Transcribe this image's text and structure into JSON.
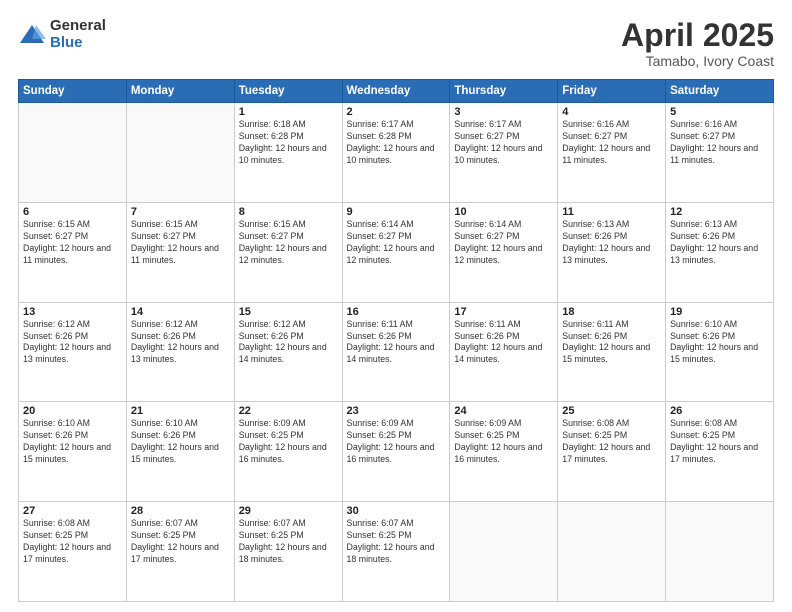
{
  "logo": {
    "general": "General",
    "blue": "Blue"
  },
  "header": {
    "title": "April 2025",
    "subtitle": "Tamabo, Ivory Coast"
  },
  "weekdays": [
    "Sunday",
    "Monday",
    "Tuesday",
    "Wednesday",
    "Thursday",
    "Friday",
    "Saturday"
  ],
  "weeks": [
    [
      {
        "day": "",
        "info": ""
      },
      {
        "day": "",
        "info": ""
      },
      {
        "day": "1",
        "info": "Sunrise: 6:18 AM\nSunset: 6:28 PM\nDaylight: 12 hours and 10 minutes."
      },
      {
        "day": "2",
        "info": "Sunrise: 6:17 AM\nSunset: 6:28 PM\nDaylight: 12 hours and 10 minutes."
      },
      {
        "day": "3",
        "info": "Sunrise: 6:17 AM\nSunset: 6:27 PM\nDaylight: 12 hours and 10 minutes."
      },
      {
        "day": "4",
        "info": "Sunrise: 6:16 AM\nSunset: 6:27 PM\nDaylight: 12 hours and 11 minutes."
      },
      {
        "day": "5",
        "info": "Sunrise: 6:16 AM\nSunset: 6:27 PM\nDaylight: 12 hours and 11 minutes."
      }
    ],
    [
      {
        "day": "6",
        "info": "Sunrise: 6:15 AM\nSunset: 6:27 PM\nDaylight: 12 hours and 11 minutes."
      },
      {
        "day": "7",
        "info": "Sunrise: 6:15 AM\nSunset: 6:27 PM\nDaylight: 12 hours and 11 minutes."
      },
      {
        "day": "8",
        "info": "Sunrise: 6:15 AM\nSunset: 6:27 PM\nDaylight: 12 hours and 12 minutes."
      },
      {
        "day": "9",
        "info": "Sunrise: 6:14 AM\nSunset: 6:27 PM\nDaylight: 12 hours and 12 minutes."
      },
      {
        "day": "10",
        "info": "Sunrise: 6:14 AM\nSunset: 6:27 PM\nDaylight: 12 hours and 12 minutes."
      },
      {
        "day": "11",
        "info": "Sunrise: 6:13 AM\nSunset: 6:26 PM\nDaylight: 12 hours and 13 minutes."
      },
      {
        "day": "12",
        "info": "Sunrise: 6:13 AM\nSunset: 6:26 PM\nDaylight: 12 hours and 13 minutes."
      }
    ],
    [
      {
        "day": "13",
        "info": "Sunrise: 6:12 AM\nSunset: 6:26 PM\nDaylight: 12 hours and 13 minutes."
      },
      {
        "day": "14",
        "info": "Sunrise: 6:12 AM\nSunset: 6:26 PM\nDaylight: 12 hours and 13 minutes."
      },
      {
        "day": "15",
        "info": "Sunrise: 6:12 AM\nSunset: 6:26 PM\nDaylight: 12 hours and 14 minutes."
      },
      {
        "day": "16",
        "info": "Sunrise: 6:11 AM\nSunset: 6:26 PM\nDaylight: 12 hours and 14 minutes."
      },
      {
        "day": "17",
        "info": "Sunrise: 6:11 AM\nSunset: 6:26 PM\nDaylight: 12 hours and 14 minutes."
      },
      {
        "day": "18",
        "info": "Sunrise: 6:11 AM\nSunset: 6:26 PM\nDaylight: 12 hours and 15 minutes."
      },
      {
        "day": "19",
        "info": "Sunrise: 6:10 AM\nSunset: 6:26 PM\nDaylight: 12 hours and 15 minutes."
      }
    ],
    [
      {
        "day": "20",
        "info": "Sunrise: 6:10 AM\nSunset: 6:26 PM\nDaylight: 12 hours and 15 minutes."
      },
      {
        "day": "21",
        "info": "Sunrise: 6:10 AM\nSunset: 6:26 PM\nDaylight: 12 hours and 15 minutes."
      },
      {
        "day": "22",
        "info": "Sunrise: 6:09 AM\nSunset: 6:25 PM\nDaylight: 12 hours and 16 minutes."
      },
      {
        "day": "23",
        "info": "Sunrise: 6:09 AM\nSunset: 6:25 PM\nDaylight: 12 hours and 16 minutes."
      },
      {
        "day": "24",
        "info": "Sunrise: 6:09 AM\nSunset: 6:25 PM\nDaylight: 12 hours and 16 minutes."
      },
      {
        "day": "25",
        "info": "Sunrise: 6:08 AM\nSunset: 6:25 PM\nDaylight: 12 hours and 17 minutes."
      },
      {
        "day": "26",
        "info": "Sunrise: 6:08 AM\nSunset: 6:25 PM\nDaylight: 12 hours and 17 minutes."
      }
    ],
    [
      {
        "day": "27",
        "info": "Sunrise: 6:08 AM\nSunset: 6:25 PM\nDaylight: 12 hours and 17 minutes."
      },
      {
        "day": "28",
        "info": "Sunrise: 6:07 AM\nSunset: 6:25 PM\nDaylight: 12 hours and 17 minutes."
      },
      {
        "day": "29",
        "info": "Sunrise: 6:07 AM\nSunset: 6:25 PM\nDaylight: 12 hours and 18 minutes."
      },
      {
        "day": "30",
        "info": "Sunrise: 6:07 AM\nSunset: 6:25 PM\nDaylight: 12 hours and 18 minutes."
      },
      {
        "day": "",
        "info": ""
      },
      {
        "day": "",
        "info": ""
      },
      {
        "day": "",
        "info": ""
      }
    ]
  ]
}
